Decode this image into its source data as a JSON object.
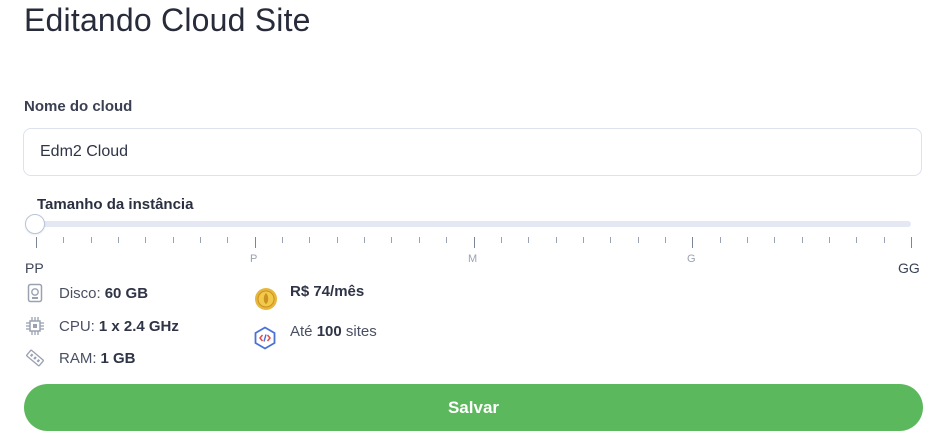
{
  "page": {
    "title": "Editando Cloud Site"
  },
  "form": {
    "name_label": "Nome do cloud",
    "name_value": "Edm2 Cloud",
    "size_label": "Tamanho da instância"
  },
  "slider": {
    "value_fraction": 0,
    "labels": {
      "pp": "PP",
      "p": "P",
      "m": "M",
      "g": "G",
      "gg": "GG"
    },
    "minor_ticks": 32
  },
  "specs": {
    "disk": {
      "prefix": "Disco:",
      "value": "60 GB",
      "icon": "disk-icon"
    },
    "cpu": {
      "prefix": "CPU:",
      "value": "1 x 2.4 GHz",
      "icon": "cpu-icon"
    },
    "ram": {
      "prefix": "RAM:",
      "value": "1 GB",
      "icon": "ram-icon"
    }
  },
  "plan": {
    "price": "R$ 74/mês",
    "price_icon": "coin-icon",
    "sites_prefix": "Até",
    "sites_count": "100",
    "sites_suffix": "sites",
    "sites_icon": "code-icon"
  },
  "actions": {
    "save_label": "Salvar"
  },
  "colors": {
    "accent_green": "#5cb85c",
    "track": "#e3e8f3"
  }
}
